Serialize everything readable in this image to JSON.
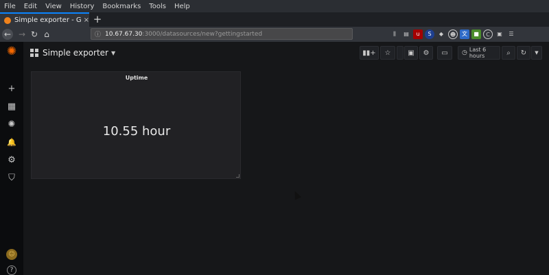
{
  "browser": {
    "menu": [
      "File",
      "Edit",
      "View",
      "History",
      "Bookmarks",
      "Tools",
      "Help"
    ],
    "tab_title": "Simple exporter - Grafana",
    "tab_close": "×",
    "new_tab": "+",
    "url_host": "10.67.67.30",
    "url_path": ":3000/datasources/new?gettingstarted"
  },
  "sidebar": {
    "logo_icon": "grafana-logo-icon",
    "items": [
      {
        "name": "create",
        "glyph": "+"
      },
      {
        "name": "dashboards",
        "glyph": "▦"
      },
      {
        "name": "explore",
        "glyph": "✺"
      },
      {
        "name": "alerting",
        "glyph": "🔔"
      },
      {
        "name": "configuration",
        "glyph": "⚙"
      },
      {
        "name": "server-admin",
        "glyph": "⛉"
      }
    ],
    "avatar_glyph": "☺",
    "help_glyph": "?"
  },
  "dashboard": {
    "title": "Simple exporter",
    "time_range": "Last 6 hours"
  },
  "panel": {
    "title": "Uptime",
    "value": "10.55 hour"
  },
  "colors": {
    "accent": "#f46800",
    "tab_highlight": "#0a84ff",
    "background": "#161719",
    "panel": "#212124"
  }
}
